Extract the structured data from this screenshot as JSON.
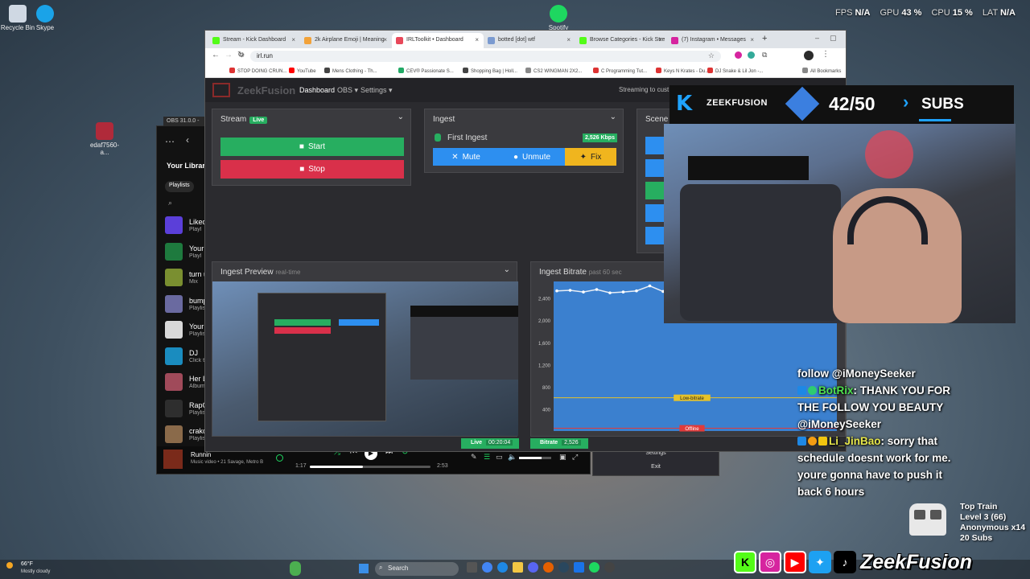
{
  "desktop": {
    "icons": [
      {
        "label": "Recycle Bin",
        "icon": "recycle-bin-icon"
      },
      {
        "label": "Skype",
        "icon": "skype-icon"
      },
      {
        "label": "Spotify",
        "icon": "spotify-icon"
      },
      {
        "label": "edaf7560-a...",
        "icon": "file-icon"
      }
    ],
    "stats": [
      {
        "label": "FPS",
        "value": "N/A"
      },
      {
        "label": "GPU",
        "value": "43 %"
      },
      {
        "label": "CPU",
        "value": "15 %"
      },
      {
        "label": "LAT",
        "value": "N/A"
      }
    ]
  },
  "spotify": {
    "obs_title": "OBS 31.0.0 -",
    "library_label": "Your Library",
    "filter_label": "Playlists",
    "items": [
      {
        "title": "Liked",
        "sub": "Playl",
        "color": "#5b3fd9"
      },
      {
        "title": "Your",
        "sub": "Playl",
        "color": "#1e7a3e"
      },
      {
        "title": "turn u",
        "sub": "Mix",
        "color": "#7a8f30"
      },
      {
        "title": "bump",
        "sub": "Playlis",
        "color": "#6a6aa0"
      },
      {
        "title": "Your",
        "sub": "Playlis",
        "color": "#d9d9d9"
      },
      {
        "title": "DJ",
        "sub": "Click t",
        "color": "#1a8cbf"
      },
      {
        "title": "Her L",
        "sub": "Album",
        "color": "#a04a5a"
      },
      {
        "title": "RapC",
        "sub": "Playlis",
        "color": "#2e2e2e"
      },
      {
        "title": "crakc",
        "sub": "Playlis",
        "color": "#8a6a4a"
      }
    ],
    "now_playing": {
      "title": "Runnin",
      "sub": "Music video • 21 Savage, Metro B",
      "elapsed": "1:17",
      "total": "2:53",
      "progress": 0.44
    }
  },
  "chrome": {
    "tabs": [
      {
        "label": "Stream - Kick Dashboard",
        "color": "#53fc18"
      },
      {
        "label": "2k Airplane Emoji | Meaning",
        "color": "#f2a23a"
      },
      {
        "label": "IRLToolkit • Dashboard",
        "color": "#e8485a",
        "active": true
      },
      {
        "label": "botted [dot] wtf",
        "color": "#7a9ad0"
      },
      {
        "label": "Browse Categories - Kick Stre",
        "color": "#53fc18"
      },
      {
        "label": "(7) Instagram • Messages",
        "color": "#d6249f"
      }
    ],
    "url": "irl.run",
    "bookmarks": [
      {
        "label": "STOP DOING CRUN...",
        "color": "#d33"
      },
      {
        "label": "YouTube",
        "color": "#f00"
      },
      {
        "label": "Mens Clothing - Th...",
        "color": "#444"
      },
      {
        "label": "CEV® Passionate S...",
        "color": "#2a6"
      },
      {
        "label": "Shopping Bag | Holl...",
        "color": "#444"
      },
      {
        "label": "CS2 WINGMAN 2X2...",
        "color": "#888"
      },
      {
        "label": "C Programming Tut...",
        "color": "#d33"
      },
      {
        "label": "Keys N Krates - Du...",
        "color": "#d33"
      },
      {
        "label": "DJ Snake & Lil Jon -...",
        "color": "#d33"
      },
      {
        "label": "All Bookmarks",
        "color": "#888"
      }
    ],
    "app": {
      "brand": "ZeekFusion",
      "nav": [
        "Dashboard",
        "OBS ▾",
        "Settings ▾"
      ],
      "streaming_to": "Streaming to cust",
      "stream_panel": {
        "title": "Stream",
        "badge": "Live",
        "start": "Start",
        "stop": "Stop"
      },
      "ingest_panel": {
        "title": "Ingest",
        "first": "First Ingest",
        "kbps": "2,526 Kbps",
        "mute": "Mute",
        "unmute": "Unmute",
        "fix": "Fix"
      },
      "scene_panel": {
        "title": "Scene"
      },
      "preview_panel": {
        "title": "Ingest Preview",
        "sub": "real-time"
      },
      "bitrate_panel": {
        "title": "Ingest Bitrate",
        "sub": "past 60 sec"
      },
      "footer": {
        "live_label": "Live",
        "live_time": "00:20:04",
        "bitrate_label": "Bitrate",
        "bitrate_value": "2,526"
      },
      "obs_menu": [
        "Settings",
        "Exit"
      ]
    }
  },
  "chart_data": {
    "type": "line",
    "title": "Ingest Bitrate",
    "subtitle": "past 60 sec",
    "y_ticks": [
      0,
      400,
      800,
      1200,
      1600,
      2000,
      2400
    ],
    "y_tick_labels": [
      "",
      "400",
      "800",
      "1,200",
      "1,600",
      "2,000",
      "2,400"
    ],
    "ylim": [
      0,
      2700
    ],
    "values": [
      2530,
      2540,
      2510,
      2555,
      2495,
      2510,
      2530,
      2620,
      2520
    ],
    "annotations": [
      {
        "label": "Low-bitrate",
        "y": 600,
        "color": "#e6c229"
      },
      {
        "label": "Offline",
        "y": 50,
        "color": "#e03b3b"
      }
    ]
  },
  "overlay": {
    "banner": {
      "brand": "ZEEKFUSION",
      "count": "42/50",
      "label": "SUBS"
    },
    "chat": [
      {
        "user": "",
        "text": "follow @iMoneySeeker"
      },
      {
        "user": "BotRix",
        "text": ": THANK YOU FOR THE FOLLOW YOU BEAUTY @iMoneySeeker",
        "color": "#4ee04e"
      },
      {
        "user": "Li_JinBao",
        "text": ": sorry that schedule doesnt work for me. youre gonna have to push it back 6 hours",
        "color": "#e6e64a"
      }
    ],
    "train": {
      "title": "Top Train",
      "level": "Level 3  (66)",
      "user": "Anonymous x14",
      "subs": "20 Subs"
    },
    "social_name": "ZeekFusion"
  },
  "taskbar": {
    "weather_temp": "66°F",
    "weather_desc": "Mostly cloudy",
    "search": "Search"
  }
}
